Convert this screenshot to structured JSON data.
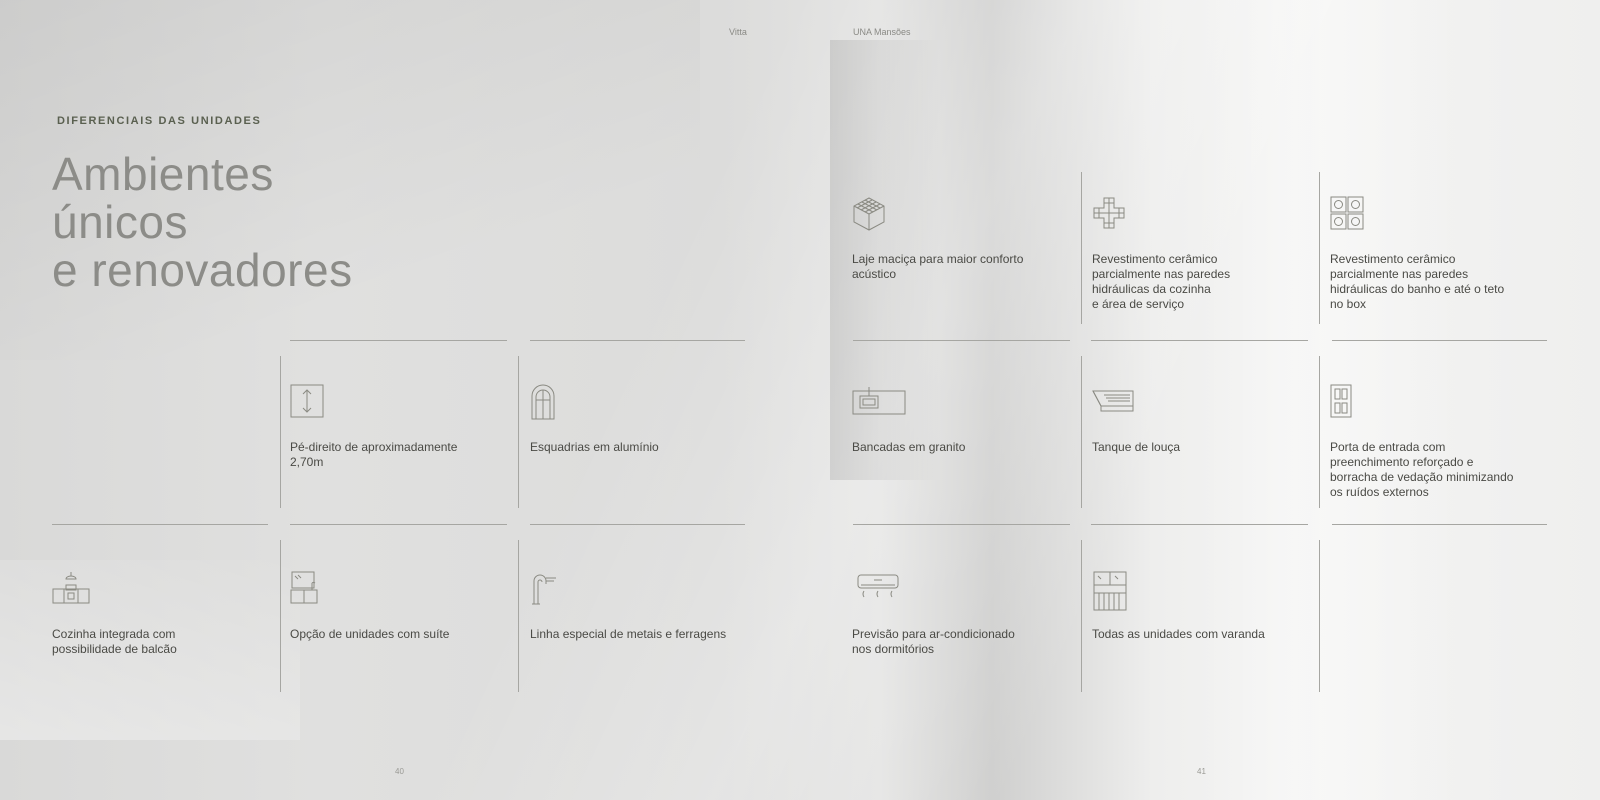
{
  "header": {
    "left": "Vitta",
    "right": "UNA Mansões"
  },
  "section_label": "DIFERENCIAIS DAS UNIDADES",
  "headline": [
    "Ambientes",
    "únicos",
    "e renovadores"
  ],
  "features": {
    "laje": "Laje maciça para maior conforto\nacústico",
    "revest_cozinha": "Revestimento cerâmico\nparcialmente nas paredes\nhidráulicas da cozinha\ne área de serviço",
    "revest_banho": "Revestimento cerâmico\nparcialmente nas paredes\nhidráulicas  do banho e até o teto\nno box",
    "pe_direito": "Pé-direito de aproximadamente\n2,70m",
    "esquadrias": "Esquadrias em alumínio",
    "bancadas": "Bancadas em granito",
    "tanque": "Tanque de louça",
    "porta": "Porta de entrada com\npreenchimento reforçado e\nborracha de vedação minimizando\nos ruídos externos",
    "cozinha": "Cozinha integrada com\npossibilidade de balcão",
    "suite": "Opção de unidades com suíte",
    "metais": "Linha especial de metais e ferragens",
    "ar": "Previsão para ar-condicionado\nnos dormitórios",
    "varanda": "Todas as unidades com varanda"
  },
  "icons": {
    "laje": "slab-icon",
    "revest_cozinha": "tile-grid-icon",
    "revest_banho": "bathroom-tiles-icon",
    "pe_direito": "ceiling-height-icon",
    "esquadrias": "window-icon",
    "bancadas": "countertop-icon",
    "tanque": "laundry-tank-icon",
    "porta": "door-icon",
    "cozinha": "kitchen-icon",
    "suite": "suite-icon",
    "metais": "faucet-icon",
    "ar": "air-conditioner-icon",
    "varanda": "balcony-icon"
  },
  "page_numbers": {
    "left": "40",
    "right": "41"
  },
  "colors": {
    "eyebrow": "#5a6050",
    "headline": "#8c8c88",
    "lines": "#a6a6a2",
    "icons": "#8a8a82"
  }
}
